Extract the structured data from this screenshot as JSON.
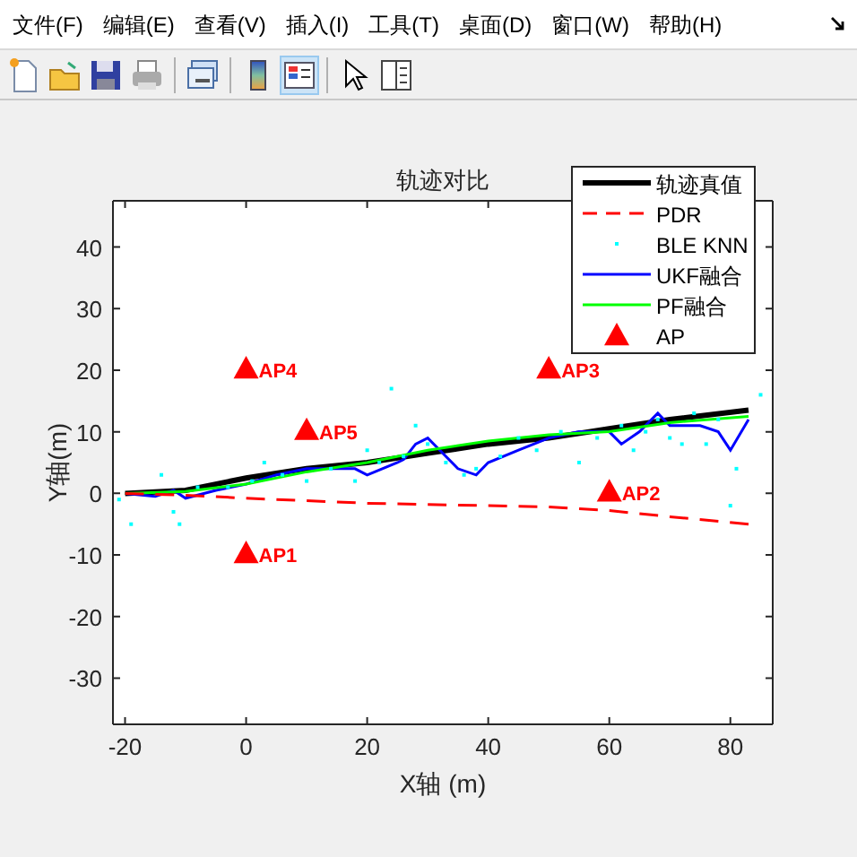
{
  "menu": [
    {
      "label": "文件(F)"
    },
    {
      "label": "编辑(E)"
    },
    {
      "label": "查看(V)"
    },
    {
      "label": "插入(I)"
    },
    {
      "label": "工具(T)"
    },
    {
      "label": "桌面(D)"
    },
    {
      "label": "窗口(W)"
    },
    {
      "label": "帮助(H)"
    }
  ],
  "toolbar": [
    {
      "kind": "new",
      "selected": false
    },
    {
      "kind": "open",
      "selected": false
    },
    {
      "kind": "save",
      "selected": false
    },
    {
      "kind": "print",
      "selected": false
    },
    {
      "kind": "sep"
    },
    {
      "kind": "link",
      "selected": false
    },
    {
      "kind": "sep"
    },
    {
      "kind": "colorbar",
      "selected": false
    },
    {
      "kind": "legend",
      "selected": true
    },
    {
      "kind": "sep"
    },
    {
      "kind": "pointer",
      "selected": false
    },
    {
      "kind": "panel",
      "selected": false
    }
  ],
  "chart_data": {
    "type": "line",
    "title": "轨迹对比",
    "xlabel": "X轴 (m)",
    "ylabel": "Y轴(m)",
    "xlim": [
      -22,
      87
    ],
    "ylim": [
      -37.5,
      47.5
    ],
    "xticks": [
      -20,
      0,
      20,
      40,
      60,
      80
    ],
    "yticks": [
      -30,
      -20,
      -10,
      0,
      10,
      20,
      30,
      40
    ],
    "legend": true,
    "series": [
      {
        "name": "轨迹真值",
        "type": "line",
        "color": "#000000",
        "x": [
          -20,
          -10,
          0,
          10,
          20,
          30,
          40,
          50,
          60,
          70,
          83
        ],
        "values": [
          0,
          0.5,
          2.5,
          4,
          5,
          6.5,
          8,
          9,
          10.5,
          12,
          13.5
        ]
      },
      {
        "name": "PDR",
        "type": "line",
        "line_style": "dashed",
        "color": "#ff0000",
        "x": [
          -20,
          -10,
          0,
          10,
          20,
          30,
          40,
          50,
          60,
          70,
          83
        ],
        "values": [
          0,
          -0.3,
          -0.8,
          -1.2,
          -1.6,
          -1.8,
          -2,
          -2.2,
          -2.8,
          -3.8,
          -5
        ]
      },
      {
        "name": "BLE KNN",
        "type": "scatter",
        "marker": "square",
        "color": "#00ffff",
        "x": [
          -21,
          -19,
          -14,
          -12,
          -11,
          -8,
          -3,
          1,
          3,
          6,
          10,
          14,
          18,
          20,
          22,
          24,
          26,
          28,
          30,
          33,
          36,
          38,
          42,
          45,
          48,
          52,
          55,
          58,
          62,
          64,
          66,
          68,
          70,
          72,
          74,
          76,
          78,
          80,
          81,
          85
        ],
        "values": [
          -1,
          -5,
          3,
          -3,
          -5,
          1,
          1,
          2,
          5,
          3,
          2,
          4,
          2,
          7,
          5,
          17,
          6,
          11,
          8,
          5,
          3,
          4,
          6,
          9,
          7,
          10,
          5,
          9,
          11,
          7,
          10,
          12,
          9,
          8,
          13,
          8,
          12,
          -2,
          4,
          16
        ]
      },
      {
        "name": "UKF融合",
        "type": "line",
        "color": "#0000ff",
        "x": [
          -20,
          -15,
          -12,
          -10,
          -5,
          0,
          5,
          10,
          15,
          18,
          20,
          25,
          26,
          28,
          30,
          32,
          35,
          38,
          40,
          45,
          50,
          55,
          60,
          62,
          65,
          68,
          70,
          75,
          78,
          80,
          83
        ],
        "values": [
          0,
          -0.5,
          0.5,
          -0.8,
          0.5,
          1.5,
          3,
          4,
          4,
          4,
          3,
          5,
          5.5,
          8,
          9,
          7,
          4,
          3,
          5,
          7,
          9,
          10,
          10,
          8,
          10,
          13,
          11,
          11,
          10,
          7,
          12
        ]
      },
      {
        "name": "PF融合",
        "type": "line",
        "color": "#00ff00",
        "x": [
          -20,
          -10,
          0,
          10,
          20,
          30,
          40,
          50,
          60,
          70,
          83
        ],
        "values": [
          0,
          0.3,
          1.5,
          3.5,
          5,
          7,
          8.5,
          9.5,
          10,
          11.5,
          12.5
        ]
      },
      {
        "name": "AP",
        "type": "scatter",
        "marker": "triangle",
        "color": "#ff0000",
        "x": [
          0,
          60,
          50,
          0,
          10
        ],
        "values": [
          -10,
          0,
          20,
          20,
          10
        ]
      }
    ],
    "annotations": [
      {
        "text": "AP1",
        "x": 0,
        "y": -10
      },
      {
        "text": "AP2",
        "x": 60,
        "y": 0
      },
      {
        "text": "AP3",
        "x": 50,
        "y": 20
      },
      {
        "text": "AP4",
        "x": 0,
        "y": 20
      },
      {
        "text": "AP5",
        "x": 10,
        "y": 10
      }
    ]
  }
}
